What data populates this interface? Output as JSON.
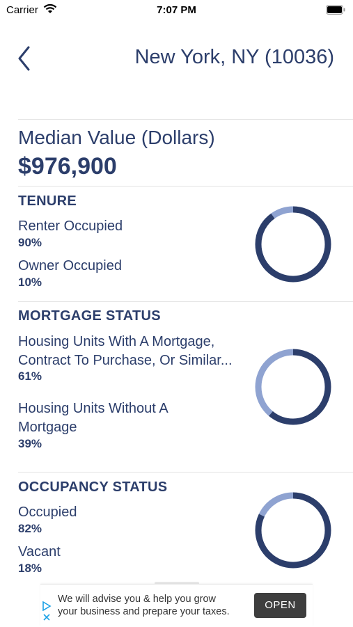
{
  "status_bar": {
    "carrier": "Carrier",
    "time": "7:07 PM"
  },
  "header": {
    "title": "New York, NY (10036)"
  },
  "median": {
    "label": "Median Value (Dollars)",
    "value": "$976,900"
  },
  "tenure": {
    "title": "TENURE",
    "items": [
      {
        "label": "Renter Occupied",
        "value": "90%",
        "fraction": 0.9
      },
      {
        "label": "Owner Occupied",
        "value": "10%",
        "fraction": 0.1
      }
    ]
  },
  "mortgage": {
    "title": "MORTGAGE STATUS",
    "items": [
      {
        "label_line1": "Housing Units With A Mortgage,",
        "label_line2": "Contract To Purchase, Or Similar...",
        "value": "61%",
        "fraction": 0.61
      },
      {
        "label_line1": "Housing Units Without A",
        "label_line2": "Mortgage",
        "value": "39%",
        "fraction": 0.39
      }
    ]
  },
  "occupancy": {
    "title": "OCCUPANCY STATUS",
    "items": [
      {
        "label": "Occupied",
        "value": "82%",
        "fraction": 0.82
      },
      {
        "label": "Vacant",
        "value": "18%",
        "fraction": 0.18
      }
    ]
  },
  "ad": {
    "line1": "We will advise you & help you grow",
    "line2": "your business and prepare your taxes.",
    "button": "OPEN"
  },
  "colors": {
    "primary": "#2c3e6b",
    "secondary": "#8fa3d1",
    "divider": "#e3e3e3"
  },
  "icons": {
    "back": "chevron-left-icon",
    "wifi": "wifi-icon",
    "battery": "battery-icon"
  }
}
